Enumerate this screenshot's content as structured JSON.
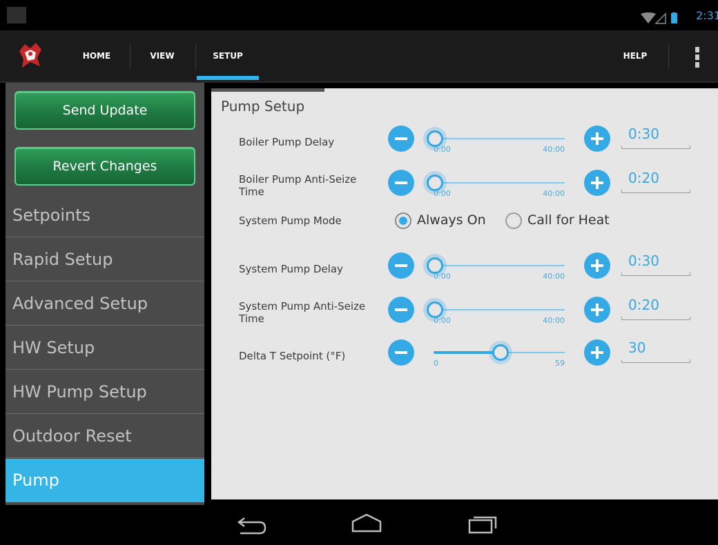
{
  "status_bar": {
    "time": "2:31"
  },
  "action_bar": {
    "tabs": [
      {
        "label": "HOME"
      },
      {
        "label": "VIEW"
      },
      {
        "label": "SETUP"
      }
    ],
    "help_label": "HELP",
    "active_tab": "SETUP"
  },
  "sidebar": {
    "send_update_label": "Send Update",
    "revert_changes_label": "Revert Changes",
    "items": [
      {
        "label": "Setpoints"
      },
      {
        "label": "Rapid Setup"
      },
      {
        "label": "Advanced Setup"
      },
      {
        "label": "HW Setup"
      },
      {
        "label": "HW Pump Setup"
      },
      {
        "label": "Outdoor Reset"
      },
      {
        "label": "Pump"
      }
    ],
    "active_item": "Pump"
  },
  "content": {
    "section_title": "Pump Setup",
    "settings": [
      {
        "label": "Boiler Pump Delay",
        "min_label": "0:00",
        "max_label": "40:00",
        "value": "0:30",
        "fraction": 0.0125
      },
      {
        "label": "Boiler Pump Anti-Seize Time",
        "min_label": "0:00",
        "max_label": "40:00",
        "value": "0:20",
        "fraction": 0.008
      },
      {
        "label": "System Pump Delay",
        "min_label": "0:00",
        "max_label": "40:00",
        "value": "0:30",
        "fraction": 0.0125
      },
      {
        "label": "System Pump Anti-Seize Time",
        "min_label": "0:00",
        "max_label": "40:00",
        "value": "0:20",
        "fraction": 0.008
      },
      {
        "label": "Delta T Setpoint (°F)",
        "min_label": "0",
        "max_label": "59",
        "value": "30",
        "fraction": 0.508
      }
    ],
    "system_pump_mode": {
      "label": "System Pump Mode",
      "options": [
        {
          "label": "Always On",
          "selected": true
        },
        {
          "label": "Call for Heat",
          "selected": false
        }
      ]
    }
  },
  "colors": {
    "accent": "#35a9e6",
    "button_green": "#1f7a42",
    "sidebar_bg": "#4a4a4a",
    "content_bg": "#e6e6e6"
  },
  "icons": [
    "app-logo-icon",
    "wifi-icon",
    "signal-icon",
    "battery-icon",
    "overflow-menu-icon",
    "minus-icon",
    "plus-icon",
    "back-icon",
    "home-icon",
    "recent-apps-icon"
  ]
}
